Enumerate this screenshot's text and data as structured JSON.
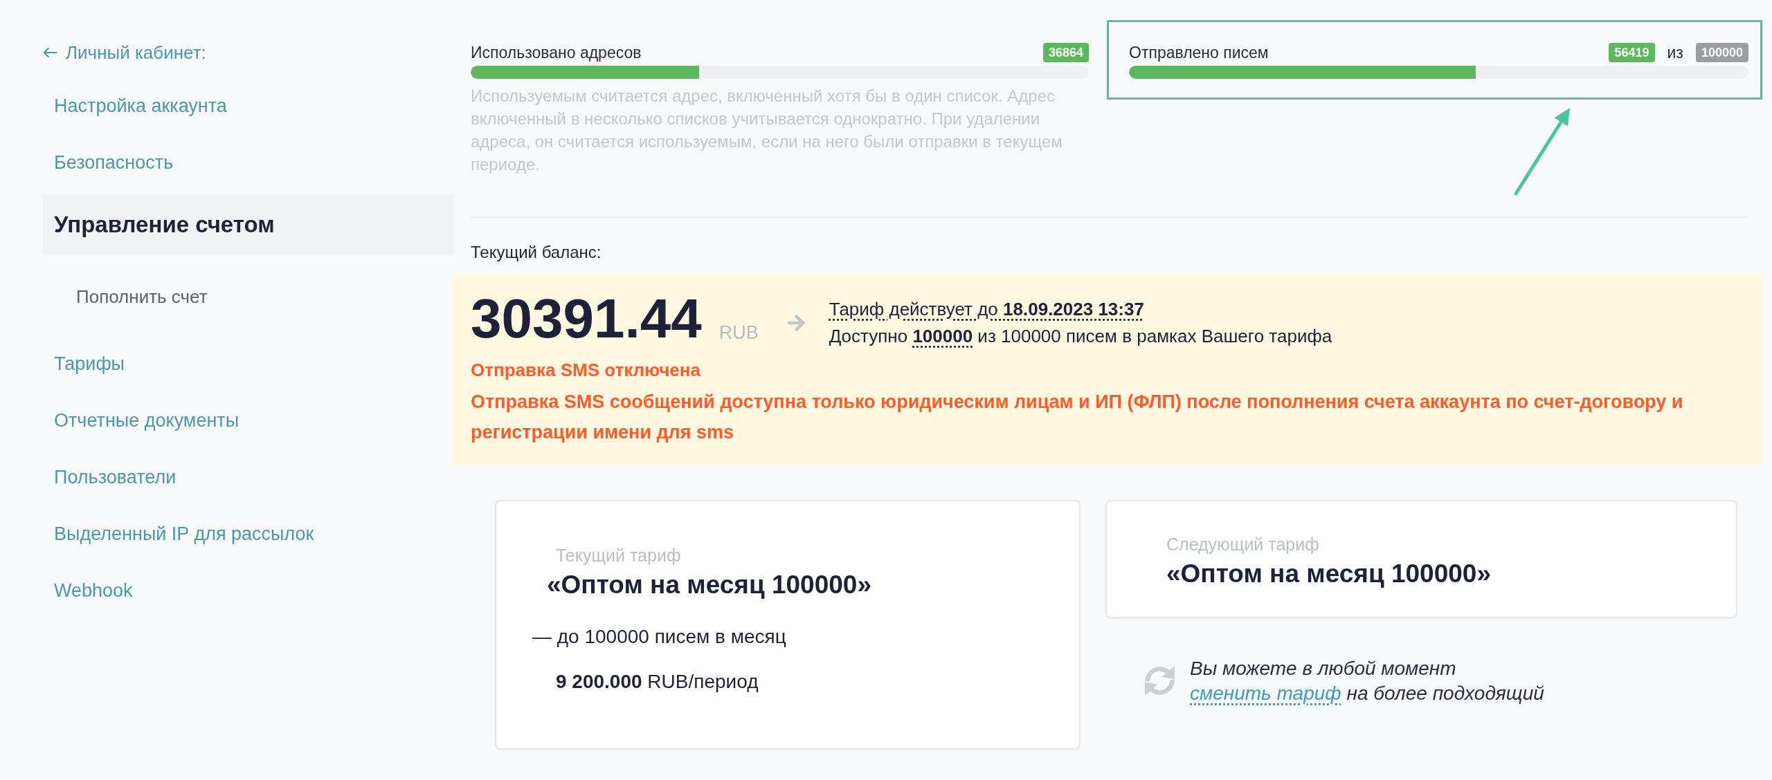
{
  "sidebar": {
    "back_link": "Личный кабинет:",
    "items": [
      {
        "label": "Настройка аккаунта",
        "selected": false
      },
      {
        "label": "Безопасность",
        "selected": false
      },
      {
        "label": "Управление счетом",
        "selected": true,
        "children": [
          {
            "label": "Пополнить счет",
            "selected": false
          }
        ]
      },
      {
        "label": "Тарифы",
        "selected": false
      },
      {
        "label": "Отчетные документы",
        "selected": false
      },
      {
        "label": "Пользователи",
        "selected": false
      },
      {
        "label": "Выделенный IP для рассылок",
        "selected": false
      },
      {
        "label": "Webhook",
        "selected": false
      }
    ]
  },
  "usage": {
    "addresses": {
      "label": "Использовано адресов",
      "count": "36864",
      "level": 0.37,
      "note": "Используемым считается адрес, включенный хотя бы в один список. Адрес включенный в несколько списков учитывается однократно. При удалении адреса, он считается используемым, если на него были отправки в текущем периоде."
    },
    "sent": {
      "label": "Отправлено писем",
      "count": "56419",
      "separator": "из",
      "total": "100000",
      "level": 0.56,
      "highlighted": true
    }
  },
  "balance": {
    "heading": "Текущий баланс:",
    "amount": "30391.44",
    "currency": "RUB",
    "validity": "Тариф действует до **18.09.2023 13:37**",
    "available": "Доступно **100000** из 100000 писем в рамках Вашего тарифа",
    "sms_status": "Отправка SMS отключена",
    "sms_notice": "Отправка SMS сообщений доступна только юридическим лицам и ИП (ФЛП) после пополнения счета аккаунта по счет-договору и регистрации имени для sms"
  },
  "tariffs": {
    "current": {
      "caption": "Текущий тариф",
      "name": "«Оптом на месяц 100000»",
      "limit": "— до 100000 писем в месяц",
      "price": "**9 200.000** RUB/период"
    },
    "next": {
      "caption": "Следующий тариф",
      "name": "«Оптом на месяц 100000»"
    },
    "change_note": {
      "before": "Вы можете в любой момент",
      "link": "сменить тариф",
      "after": "на более подходящий"
    }
  }
}
